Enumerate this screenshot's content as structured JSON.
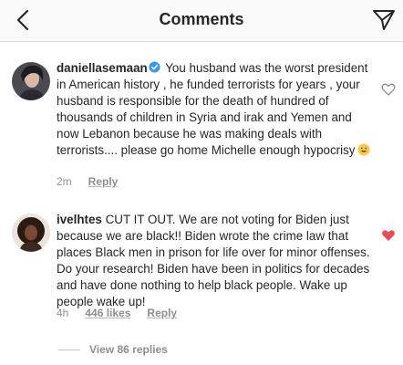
{
  "header": {
    "title": "Comments",
    "back_icon": "chevron-left-icon",
    "direct_icon": "paper-plane-icon"
  },
  "comments": [
    {
      "username": "daniellasemaan",
      "verified": true,
      "text": "You husband was the worst president in American history , he funded terrorists for years , your husband is responsible for the death of hundred of thousands of children in Syria and irak and Yemen and now Lebanon because he was making deals with terrorists.... please go home Michelle enough hypocrisy",
      "emoji": "grinning-sweat-emoji",
      "time": "2m",
      "reply_label": "Reply",
      "liked": false
    },
    {
      "username": "ivelhtes",
      "verified": false,
      "text": "CUT IT OUT. We are not voting for Biden just because we are black!! Biden wrote the crime law that places Black men in prison for life over for minor offenses. Do your research! Biden have been in politics for decades and have done nothing to help black people. Wake up people wake up!",
      "time": "4h",
      "likes_label": "446 likes",
      "reply_label": "Reply",
      "liked": true
    }
  ],
  "view_replies_label": "View 86 replies",
  "colors": {
    "text": "#262626",
    "muted": "#8e8e8e",
    "heart_liked": "#ed4956",
    "verified": "#3897f0"
  }
}
